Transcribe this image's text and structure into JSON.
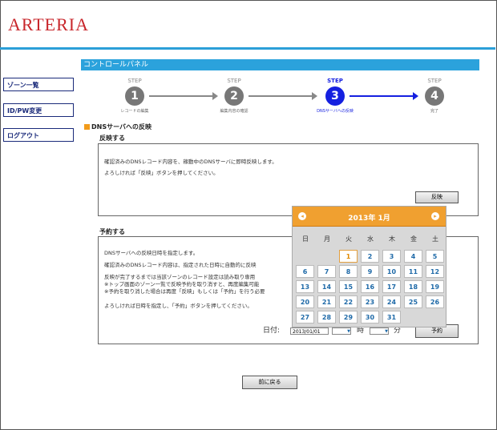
{
  "brand": {
    "logo": "ARTERIA"
  },
  "sidebar": {
    "items": [
      {
        "label": "ゾーン一覧"
      },
      {
        "label": "ID/PW変更"
      },
      {
        "label": "ログアウト"
      }
    ]
  },
  "panel": {
    "title": "コントロールパネル"
  },
  "steps": [
    {
      "label": "STEP",
      "number": "4",
      "caption": "完了"
    },
    {
      "label": "STEP",
      "number": "1",
      "caption": "レコードの編集"
    },
    {
      "label": "STEP",
      "number": "2",
      "caption": "編集内容の確認"
    },
    {
      "label": "STEP",
      "number": "3",
      "caption": "DNSサーバへの反映"
    }
  ],
  "section": {
    "title": "DNSサーバへの反映"
  },
  "reflect": {
    "title": "反映する",
    "line1": "確認済みのDNSレコード内容を、稼動中のDNSサーバに即時反映します。",
    "line2": "よろしければ「反映」ボタンを押してください。",
    "button": "反映"
  },
  "reserve": {
    "title": "予約する",
    "line1": "DNSサーバへの反映日時を指定します。",
    "line2": "確認済みのDNSレコード内容は、指定された日時に自動的に反映",
    "line3": "反映が完了するまでは当該ゾーンのレコード設定は読み取り専用",
    "line4": "※トップ画面のゾーン一覧で反映予約を取り消すと、再度編集可能",
    "line5": "※予約を取り消した場合は再度「反映」もしくは「予約」を行う必要",
    "line6": "よろしければ日時を指定し、「予約」ボタンを押してください。",
    "date_label": "日付:",
    "date_value": "2013/01/01",
    "hour_label": "時",
    "minute_label": "分",
    "button": "予約"
  },
  "calendar": {
    "title": "2013年 1月",
    "prev": "◂",
    "next": "▸",
    "weekdays": [
      "日",
      "月",
      "火",
      "水",
      "木",
      "金",
      "土"
    ],
    "days": [
      "1",
      "2",
      "3",
      "4",
      "5",
      "6",
      "7",
      "8",
      "9",
      "10",
      "11",
      "12",
      "13",
      "14",
      "15",
      "16",
      "17",
      "18",
      "19",
      "20",
      "21",
      "22",
      "23",
      "24",
      "25",
      "26",
      "27",
      "28",
      "29",
      "30",
      "31"
    ]
  },
  "footer": {
    "back_button": "前に戻る"
  }
}
